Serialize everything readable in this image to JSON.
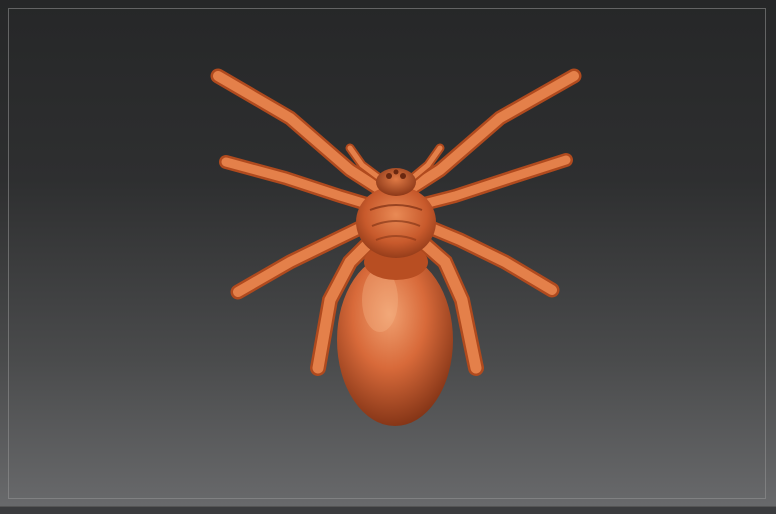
{
  "viewport": {
    "background_top": "#262728",
    "background_bottom": "#6a6b6d",
    "frame_color": "#969696"
  },
  "model": {
    "subject": "spider",
    "material_color": "#d86a3a",
    "shadow_color": "#7a2e12",
    "highlight_color": "#f5a577",
    "leg_count": 8
  }
}
